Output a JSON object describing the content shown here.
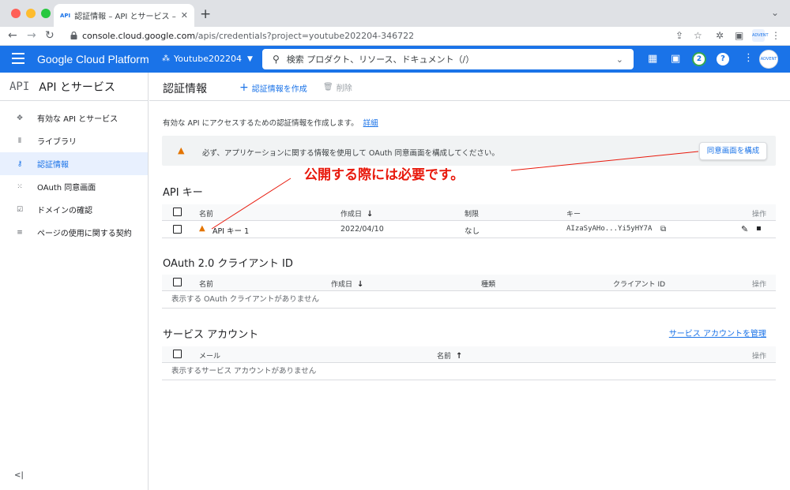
{
  "browser": {
    "tab_title": "認証情報 – API とサービス – Yout",
    "tab_favicon": "API",
    "url_host": "console.cloud.google.com",
    "url_path": "/apis/credentials?project=youtube202204-346722",
    "extension_badge": "ADVENT"
  },
  "header": {
    "brand": "Google Cloud Platform",
    "project": "Youtube202204",
    "search_placeholder": "検索 プロダクト、リソース、ドキュメント（/）",
    "notification_count": "2",
    "help": "?",
    "accent": "#1a73e8"
  },
  "sidebar": {
    "logo": "API",
    "title": "API とサービス",
    "items": [
      {
        "label": "有効な API とサービス",
        "icon": "diamond-move-icon"
      },
      {
        "label": "ライブラリ",
        "icon": "library-icon"
      },
      {
        "label": "認証情報",
        "icon": "key-icon",
        "active": true
      },
      {
        "label": "OAuth 同意画面",
        "icon": "grid-dots-icon"
      },
      {
        "label": "ドメインの確認",
        "icon": "check-box-icon"
      },
      {
        "label": "ページの使用に関する契約",
        "icon": "settings-list-icon"
      }
    ],
    "collapse": "<|"
  },
  "main": {
    "title": "認証情報",
    "create_label": "認証情報を作成",
    "delete_label": "削除",
    "intro_text": "有効な API にアクセスするための認証情報を作成します。",
    "intro_link": "詳細",
    "banner_text": "必ず、アプリケーションに関する情報を使用して OAuth 同意画面を構成してください。",
    "banner_button": "同意画面を構成",
    "annotation": "公開する際には必要です。",
    "api_keys": {
      "title": "API キー",
      "headers": {
        "name": "名前",
        "created": "作成日",
        "restriction": "制限",
        "key": "キー",
        "actions": "操作"
      },
      "rows": [
        {
          "name": "API キー 1",
          "created": "2022/04/10",
          "restriction": "なし",
          "key": "AIzaSyAHo...Yi5yHY7A"
        }
      ]
    },
    "oauth": {
      "title": "OAuth 2.0 クライアント ID",
      "headers": {
        "name": "名前",
        "created": "作成日",
        "type": "種類",
        "client_id": "クライアント ID",
        "actions": "操作"
      },
      "empty": "表示する OAuth クライアントがありません"
    },
    "service_accounts": {
      "title": "サービス アカウント",
      "manage_link": "サービス アカウントを管理",
      "headers": {
        "email": "メール",
        "name": "名前",
        "actions": "操作"
      },
      "empty": "表示するサービス アカウントがありません"
    }
  }
}
